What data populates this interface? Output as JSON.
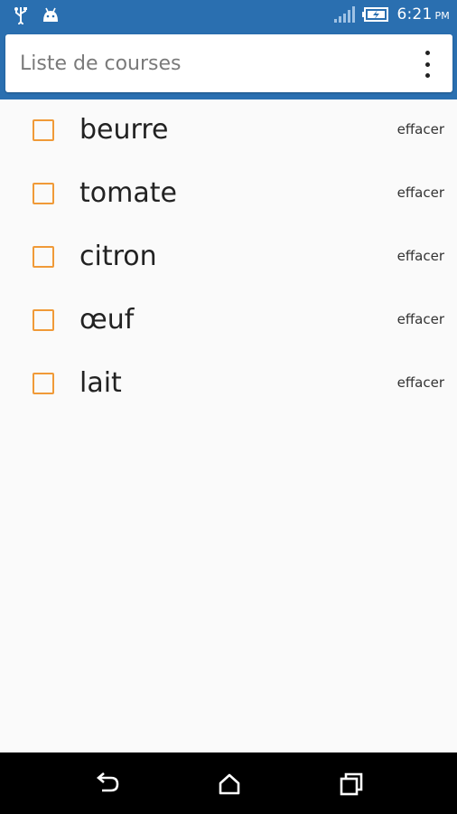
{
  "status_bar": {
    "time": "6:21",
    "ampm": "PM",
    "icons": [
      "usb-icon",
      "android-icon",
      "signal-icon",
      "battery-charging-icon"
    ]
  },
  "search": {
    "placeholder": "Liste de courses"
  },
  "menu": {
    "icon": "more-vert-icon"
  },
  "items": [
    {
      "label": "beurre",
      "action": "effacer",
      "checked": false
    },
    {
      "label": "tomate",
      "action": "effacer",
      "checked": false
    },
    {
      "label": "citron",
      "action": "effacer",
      "checked": false
    },
    {
      "label": "œuf",
      "action": "effacer",
      "checked": false
    },
    {
      "label": "lait",
      "action": "effacer",
      "checked": false
    }
  ],
  "nav": {
    "icons": [
      "back-icon",
      "home-icon",
      "recent-apps-icon"
    ]
  },
  "colors": {
    "primary": "#2a6fb0",
    "checkbox": "#f09a38",
    "background": "#fafafa"
  }
}
